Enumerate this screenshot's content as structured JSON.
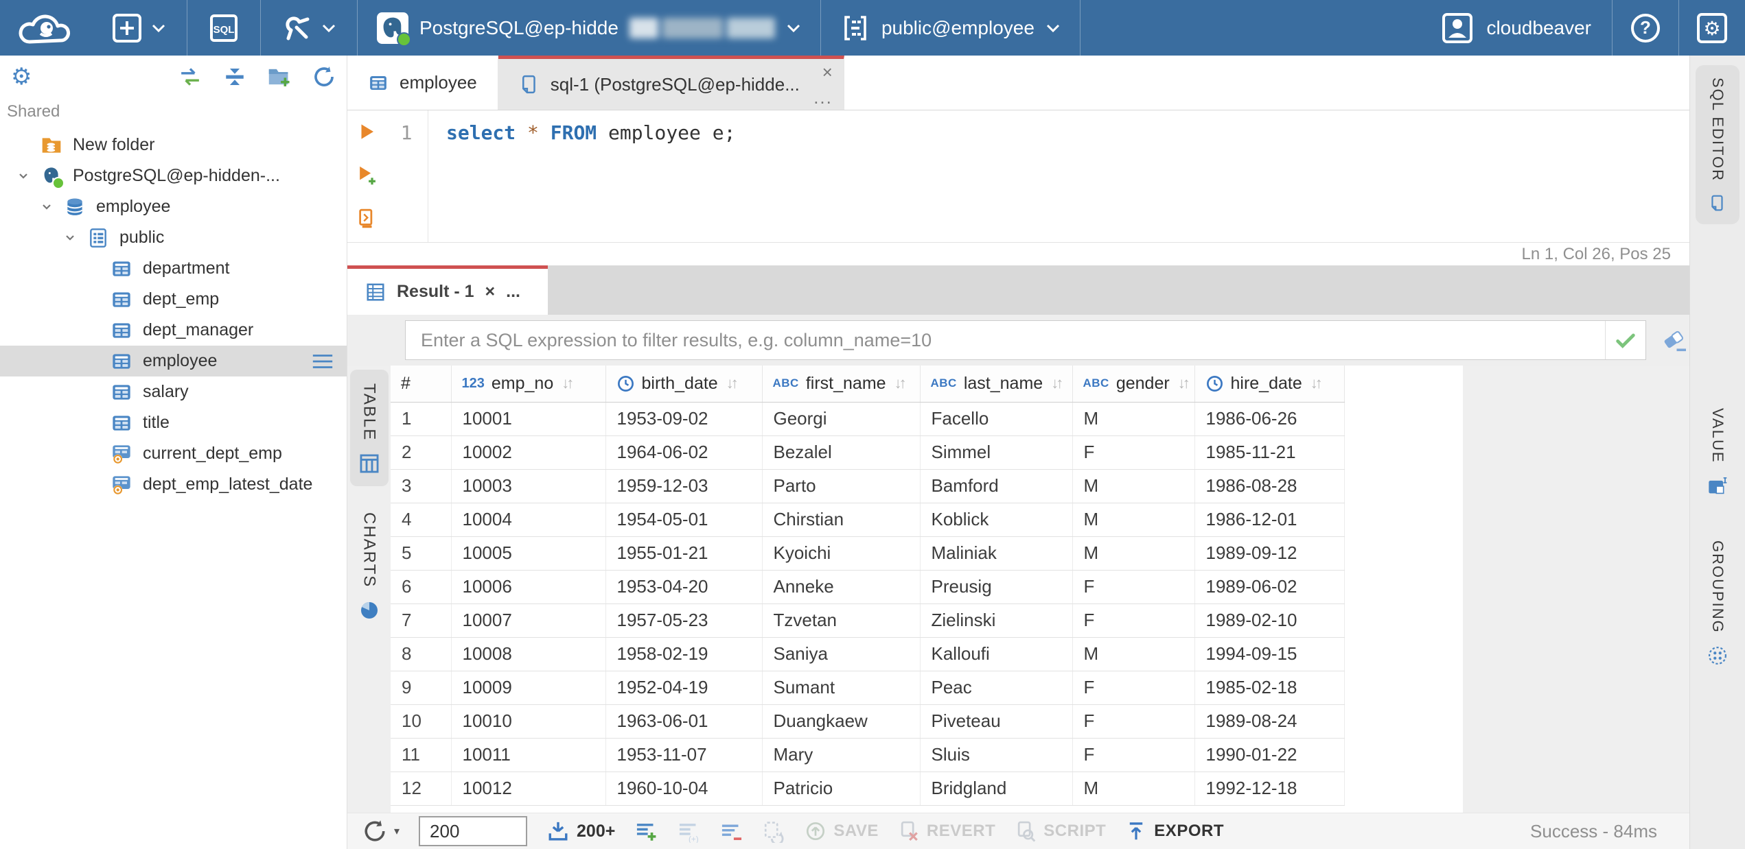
{
  "topbar": {
    "connection": {
      "label": "PostgreSQL@ep-hidde",
      "redacted": true
    },
    "schema": {
      "label": "public@employee"
    },
    "user": {
      "label": "cloudbeaver"
    }
  },
  "sidebar": {
    "section_label": "Shared",
    "tree": [
      {
        "label": "New folder",
        "icon": "folderdb",
        "level": 0,
        "chevron": false,
        "selected": false,
        "menu": false
      },
      {
        "label": "PostgreSQL@ep-hidden-...",
        "icon": "postgres",
        "level": 0,
        "chevron": true,
        "selected": false,
        "menu": false
      },
      {
        "label": "employee",
        "icon": "dbcyl",
        "level": 1,
        "chevron": true,
        "selected": false,
        "menu": false
      },
      {
        "label": "public",
        "icon": "schemadoc",
        "level": 2,
        "chevron": true,
        "selected": false,
        "menu": false
      },
      {
        "label": "department",
        "icon": "tableicon",
        "level": 3,
        "chevron": false,
        "selected": false,
        "menu": false
      },
      {
        "label": "dept_emp",
        "icon": "tableicon",
        "level": 3,
        "chevron": false,
        "selected": false,
        "menu": false
      },
      {
        "label": "dept_manager",
        "icon": "tableicon",
        "level": 3,
        "chevron": false,
        "selected": false,
        "menu": false
      },
      {
        "label": "employee",
        "icon": "tableicon",
        "level": 3,
        "chevron": false,
        "selected": true,
        "menu": true
      },
      {
        "label": "salary",
        "icon": "tableicon",
        "level": 3,
        "chevron": false,
        "selected": false,
        "menu": false
      },
      {
        "label": "title",
        "icon": "tableicon",
        "level": 3,
        "chevron": false,
        "selected": false,
        "menu": false
      },
      {
        "label": "current_dept_emp",
        "icon": "viewicon",
        "level": 3,
        "chevron": false,
        "selected": false,
        "menu": false
      },
      {
        "label": "dept_emp_latest_date",
        "icon": "viewicon",
        "level": 3,
        "chevron": false,
        "selected": false,
        "menu": false
      }
    ]
  },
  "tabs": {
    "employee": {
      "label": "employee"
    },
    "sql": {
      "label": "sql-1 (PostgreSQL@ep-hidde...",
      "close": "×",
      "menu_dots": "..."
    }
  },
  "editor": {
    "line_number": "1",
    "sql_tokens": [
      {
        "text": "select",
        "type": "kw"
      },
      {
        "text": " ",
        "type": "plain"
      },
      {
        "text": "*",
        "type": "star"
      },
      {
        "text": " ",
        "type": "plain"
      },
      {
        "text": "FROM",
        "type": "kw"
      },
      {
        "text": " employee e;",
        "type": "plain"
      }
    ],
    "status": "Ln 1, Col 26, Pos 25"
  },
  "result": {
    "tab_label": "Result - 1",
    "tab_close": "×",
    "tab_dots": "...",
    "filter_placeholder": "Enter a SQL expression to filter results, e.g. column_name=10",
    "left_tabs": [
      {
        "label": "TABLE",
        "icon": "tablerail",
        "active": true
      },
      {
        "label": "CHARTS",
        "icon": "pie",
        "active": false
      }
    ],
    "columns": [
      {
        "label": "#",
        "type": "none",
        "sortable": false
      },
      {
        "label": "emp_no",
        "type": "123",
        "sortable": true
      },
      {
        "label": "birth_date",
        "type": "clock",
        "sortable": true
      },
      {
        "label": "first_name",
        "type": "abc",
        "sortable": true
      },
      {
        "label": "last_name",
        "type": "abc",
        "sortable": true
      },
      {
        "label": "gender",
        "type": "abc",
        "sortable": true
      },
      {
        "label": "hire_date",
        "type": "clock",
        "sortable": true
      }
    ],
    "rows": [
      [
        "1",
        "10001",
        "1953-09-02",
        "Georgi",
        "Facello",
        "M",
        "1986-06-26"
      ],
      [
        "2",
        "10002",
        "1964-06-02",
        "Bezalel",
        "Simmel",
        "F",
        "1985-11-21"
      ],
      [
        "3",
        "10003",
        "1959-12-03",
        "Parto",
        "Bamford",
        "M",
        "1986-08-28"
      ],
      [
        "4",
        "10004",
        "1954-05-01",
        "Chirstian",
        "Koblick",
        "M",
        "1986-12-01"
      ],
      [
        "5",
        "10005",
        "1955-01-21",
        "Kyoichi",
        "Maliniak",
        "M",
        "1989-09-12"
      ],
      [
        "6",
        "10006",
        "1953-04-20",
        "Anneke",
        "Preusig",
        "F",
        "1989-06-02"
      ],
      [
        "7",
        "10007",
        "1957-05-23",
        "Tzvetan",
        "Zielinski",
        "F",
        "1989-02-10"
      ],
      [
        "8",
        "10008",
        "1958-02-19",
        "Saniya",
        "Kalloufi",
        "M",
        "1994-09-15"
      ],
      [
        "9",
        "10009",
        "1952-04-19",
        "Sumant",
        "Peac",
        "F",
        "1985-02-18"
      ],
      [
        "10",
        "10010",
        "1963-06-01",
        "Duangkaew",
        "Piveteau",
        "F",
        "1989-08-24"
      ],
      [
        "11",
        "10011",
        "1953-11-07",
        "Mary",
        "Sluis",
        "F",
        "1990-01-22"
      ],
      [
        "12",
        "10012",
        "1960-10-04",
        "Patricio",
        "Bridgland",
        "M",
        "1992-12-18"
      ]
    ],
    "toolbar": {
      "row_limit_value": "200",
      "fetch_label": "200+",
      "save_label": "SAVE",
      "revert_label": "REVERT",
      "script_label": "SCRIPT",
      "export_label": "EXPORT"
    },
    "status": "Success - 84ms"
  },
  "right_rail": {
    "sql_editor_label": "SQL EDITOR",
    "value_label": "VALUE",
    "grouping_label": "GROUPING"
  },
  "colors": {
    "topbar_blue": "#3a6d9f",
    "accent_blue": "#4a86c4",
    "accent_red": "#cf5151",
    "accent_green": "#67c23a",
    "accent_orange": "#e8872b",
    "selected_row_gray": "#dcdcdc"
  }
}
